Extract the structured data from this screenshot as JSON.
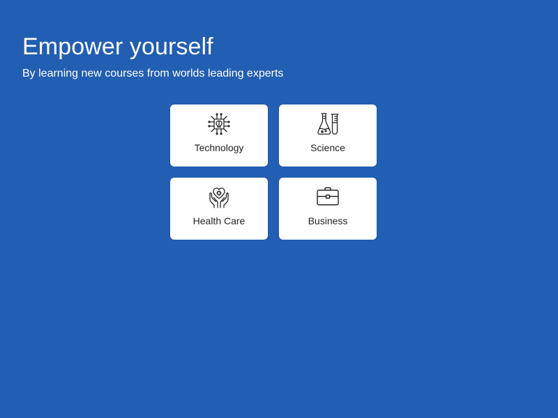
{
  "hero": {
    "title": "Empower yourself",
    "subtitle": "By learning new courses from worlds leading experts"
  },
  "categories": [
    {
      "label": "Technology",
      "icon": "chip-brain-icon"
    },
    {
      "label": "Science",
      "icon": "flask-test-tube-icon"
    },
    {
      "label": "Health Care",
      "icon": "hands-heart-icon"
    },
    {
      "label": "Business",
      "icon": "briefcase-icon"
    }
  ],
  "colors": {
    "background": "#225eb2",
    "card": "#ffffff",
    "text_light": "#ffffff",
    "text_dark": "#222222"
  }
}
